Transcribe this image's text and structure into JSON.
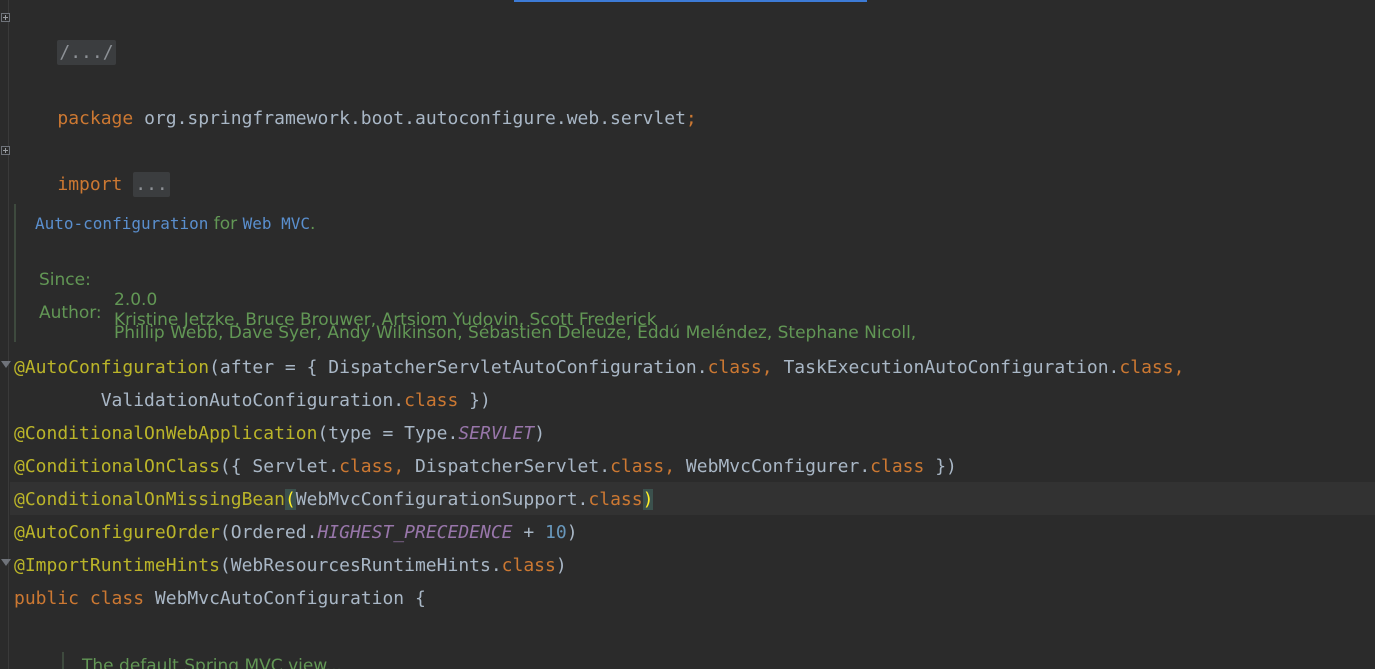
{
  "editor": {
    "folded_header": "/.../",
    "package_line": {
      "keyword": "package",
      "name": "org.springframework.boot.autoconfigure.web.servlet",
      "semicolon": ";"
    },
    "import_line": {
      "keyword": "import",
      "folded": "..."
    },
    "javadoc": {
      "summary_code_1": "Auto-configuration",
      "summary_text_1": " for ",
      "summary_code_2": "Web MVC",
      "summary_text_2": ".",
      "since_label": "Since:",
      "since_value": "2.0.0",
      "author_label": "Author:",
      "author_line_1": "Phillip Webb, Dave Syer, Andy Wilkinson, Sébastien Deleuze, Eddú Meléndez, Stephane Nicoll,",
      "author_line_2": "Kristine Jetzke, Bruce Brouwer, Artsiom Yudovin, Scott Frederick"
    },
    "code": {
      "l1_ann": "@AutoConfiguration",
      "l1_a": "(after = { DispatcherServletAutoConfiguration.",
      "class_kw": "class",
      "comma": ",",
      "l1_b": " TaskExecutionAutoConfiguration.",
      "l2_a": "        ValidationAutoConfiguration.",
      "l2_b": " })",
      "l3_ann": "@ConditionalOnWebApplication",
      "l3_a": "(type = Type.",
      "l3_const": "SERVLET",
      "l3_b": ")",
      "l4_ann": "@ConditionalOnClass",
      "l4_a": "({ Servlet.",
      "l4_b": " DispatcherServlet.",
      "l4_c": " WebMvcConfigurer.",
      "l4_d": " })",
      "l5_ann": "@ConditionalOnMissingBean",
      "l5_open": "(",
      "l5_a": "WebMvcConfigurationSupport.",
      "l5_close": ")",
      "l6_ann": "@AutoConfigureOrder",
      "l6_a": "(Ordered.",
      "l6_const": "HIGHEST_PRECEDENCE",
      "l6_b": " + ",
      "l6_num": "10",
      "l6_c": ")",
      "l7_ann": "@ImportRuntimeHints",
      "l7_a": "(WebResourcesRuntimeHints.",
      "l7_b": ")",
      "l8_kw1": "public",
      "l8_kw2": "class",
      "l8_name": " WebMvcAutoConfiguration {",
      "next_doc_partial": "The default Spring MVC view..."
    },
    "colors": {
      "background": "#2b2b2b",
      "keyword": "#cc7832",
      "annotation": "#bbb529",
      "static_field": "#9876aa",
      "number": "#6897bb",
      "doc": "#629755",
      "doc_link": "#5a8fce"
    }
  }
}
